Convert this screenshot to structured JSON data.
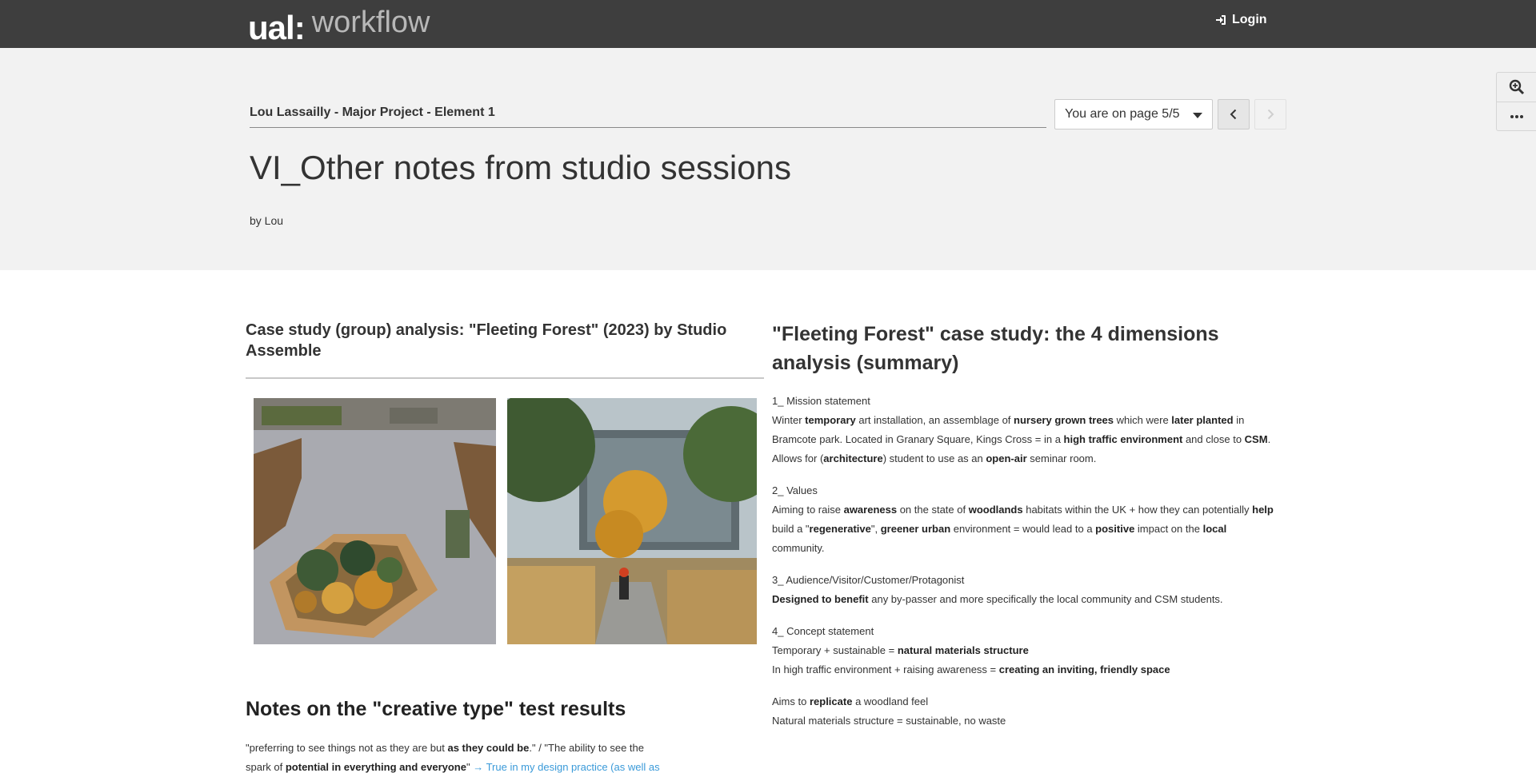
{
  "topbar": {
    "logo_main": "ual",
    "logo_separator": ":",
    "logo_app": "workflow",
    "login_label": "Login"
  },
  "header": {
    "portfolio_title": "Lou Lassailly - Major Project - Element 1",
    "page_selector": "You are on page 5/5",
    "page_title": "VI_Other notes from studio sessions",
    "byline": "by Lou"
  },
  "left": {
    "case_heading": "Case study (group) analysis: \"Fleeting Forest\" (2023) by Studio Assemble",
    "notes_title": "Notes on the \"creative type\" test results",
    "notes_lines": {
      "l1_a": "\"preferring to see things not as they are but ",
      "l1_b": "as they could be",
      "l1_c": ".\" / \"The ability to see the",
      "l2_a": "spark of ",
      "l2_b": "potential in everything and everyone",
      "l2_c": "\" ",
      "l2_link": "→ True in my design practice (as well as"
    }
  },
  "right": {
    "summary_title": "\"Fleeting Forest\" case study: the 4 dimensions analysis (summary)",
    "s1": {
      "heading": "1_ Mission statement",
      "t1": "Winter ",
      "b1": "temporary",
      "t2": " art installation, an assemblage of ",
      "b2": "nursery grown trees",
      "t3": " which were ",
      "b3": "later planted",
      "t4": " in",
      "t5": "Bramcote park. Located in Granary Square, Kings Cross = in a ",
      "b4": "high traffic environment",
      "t6": " and close to ",
      "b5": "CSM",
      "t7": ".",
      "t8": "Allows for (",
      "b6": "architecture",
      "t9": ") student to use as an ",
      "b7": "open-air",
      "t10": " seminar room."
    },
    "s2": {
      "heading": "2_ Values",
      "t1": "Aiming to raise ",
      "b1": "awareness",
      "t2": " on the state of ",
      "b2": "woodlands",
      "t3": " habitats within the UK + how they can potentially ",
      "b3": "help",
      "t4": "build a \"",
      "b4": "regenerative",
      "t5": "\", ",
      "b5": "greener urban",
      "t6": " environment = would lead to a ",
      "b6": "positive",
      "t7": " impact on the ",
      "b7": "local",
      "t8": "community."
    },
    "s3": {
      "heading": "3_ Audience/Visitor/Customer/Protagonist",
      "b1": "Designed to benefit",
      "t1": " any by-passer and more specifically the local community and CSM students."
    },
    "s4": {
      "heading": "4_ Concept statement",
      "t1": "Temporary + sustainable = ",
      "b1": "natural materials structure",
      "t2": "In high traffic environment + raising awareness = ",
      "b2": "creating an inviting, friendly space"
    },
    "s5": {
      "t1": "Aims to ",
      "b1": "replicate",
      "t2": " a woodland feel",
      "t3": "Natural materials structure = sustainable, no waste"
    }
  },
  "icons": {
    "login": "sign-in-icon",
    "prev": "chevron-left-icon",
    "next": "chevron-right-icon",
    "zoom": "zoom-in-icon",
    "more": "ellipsis-icon"
  },
  "colors": {
    "topbar": "#3e3e3e",
    "header_bg": "#f2f2f2",
    "link": "#3a9ad9"
  }
}
